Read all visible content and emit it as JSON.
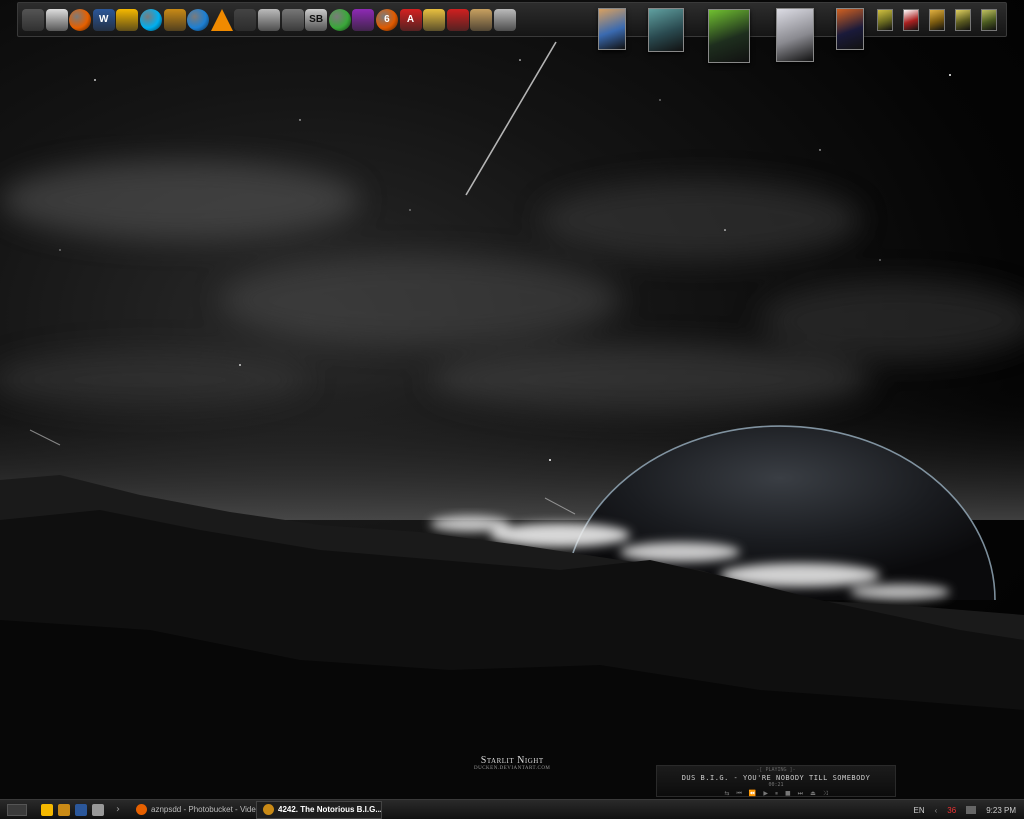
{
  "dock": {
    "icons": [
      {
        "name": "computer-icon",
        "color": "#555555",
        "glyph": ""
      },
      {
        "name": "documents-icon",
        "color": "#dddddd",
        "glyph": ""
      },
      {
        "name": "firefox-icon",
        "color": "#e66000",
        "glyph": ""
      },
      {
        "name": "word-icon",
        "color": "#2b579a",
        "glyph": "W"
      },
      {
        "name": "aim-icon",
        "color": "#f5b800",
        "glyph": ""
      },
      {
        "name": "skype-icon",
        "color": "#00aff0",
        "glyph": ""
      },
      {
        "name": "winamp-icon",
        "color": "#c98a16",
        "glyph": ""
      },
      {
        "name": "messenger-icon",
        "color": "#1d7fd3",
        "glyph": ""
      },
      {
        "name": "vlc-icon",
        "color": "#f08a00",
        "glyph": ""
      },
      {
        "name": "video-editor-icon",
        "color": "#444444",
        "glyph": ""
      },
      {
        "name": "keyboard-icon",
        "color": "#bbbbbb",
        "glyph": ""
      },
      {
        "name": "steam-icon",
        "color": "#777777",
        "glyph": ""
      },
      {
        "name": "sb-icon",
        "color": "#cccccc",
        "glyph": "SB"
      },
      {
        "name": "utorrent-icon",
        "color": "#3aa83a",
        "glyph": ""
      },
      {
        "name": "imesh-icon",
        "color": "#8e2ab5",
        "glyph": ""
      },
      {
        "name": "speed6-icon",
        "color": "#e05a00",
        "glyph": "6"
      },
      {
        "name": "acrobat-icon",
        "color": "#d42020",
        "glyph": "A"
      },
      {
        "name": "popcorn-icon",
        "color": "#e8c040",
        "glyph": ""
      },
      {
        "name": "magnet-icon",
        "color": "#d02020",
        "glyph": ""
      },
      {
        "name": "colosseum-icon",
        "color": "#c8a060",
        "glyph": ""
      },
      {
        "name": "trash-icon",
        "color": "#bbbbbb",
        "glyph": ""
      }
    ],
    "games": [
      {
        "name": "game-box-1",
        "color": "#3a6ab0",
        "accent": "#d8a060"
      },
      {
        "name": "game-box-2",
        "color": "#2a4a50",
        "accent": "#60a0a0"
      },
      {
        "name": "game-box-command-conquer",
        "color": "#1e2e1e",
        "accent": "#70c030"
      },
      {
        "name": "game-box-warcraft",
        "color": "#8a8a90",
        "accent": "#dcdce4"
      },
      {
        "name": "game-box-starcraft",
        "color": "#1a1a3a",
        "accent": "#d06020"
      },
      {
        "name": "game-small-1",
        "color": "#6a6a20",
        "accent": "#d0c040"
      },
      {
        "name": "game-small-2",
        "color": "#aa2020",
        "accent": "#ffffff"
      },
      {
        "name": "game-small-3",
        "color": "#7a5a10",
        "accent": "#e0b040"
      },
      {
        "name": "game-small-4",
        "color": "#5a5a20",
        "accent": "#e0d060"
      },
      {
        "name": "game-small-5",
        "color": "#4a5a20",
        "accent": "#c0c060"
      }
    ]
  },
  "watermark": {
    "title": "Starlit Night",
    "credit": "DUCKEN.DEVIANTART.COM"
  },
  "player": {
    "status": "-[ PLAYING ]-",
    "track": "DUS B.I.G. - YOU'RE NOBODY TILL SOMEBODY",
    "time": "00:21"
  },
  "taskbar": {
    "tasks": [
      {
        "label": "aznpsdd - Photobucket - Vide...",
        "icon_color": "#e66000",
        "active": false
      },
      {
        "label": "4242. The Notorious B.I.G....",
        "icon_color": "#c98a16",
        "active": true
      }
    ],
    "tray": {
      "language": "EN",
      "temperature": "36",
      "clock": "9:23 PM"
    }
  }
}
